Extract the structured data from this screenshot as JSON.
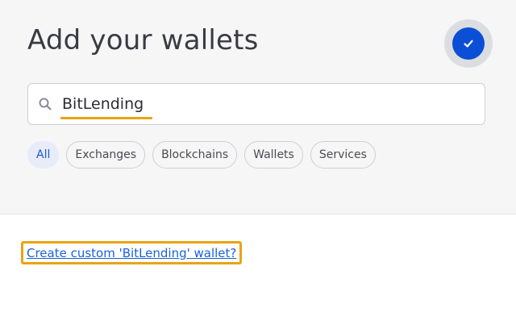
{
  "header": {
    "title": "Add your wallets"
  },
  "done_button": {
    "icon": "checkmark-icon",
    "color": "#0a4fd6"
  },
  "search": {
    "icon": "search-icon",
    "value": "BitLending",
    "highlight_color": "#e9a410"
  },
  "filters": [
    {
      "label": "All",
      "active": true
    },
    {
      "label": "Exchanges",
      "active": false
    },
    {
      "label": "Blockchains",
      "active": false
    },
    {
      "label": "Wallets",
      "active": false
    },
    {
      "label": "Services",
      "active": false
    }
  ],
  "results": {
    "custom_wallet_link": "Create custom 'BitLending' wallet?"
  }
}
